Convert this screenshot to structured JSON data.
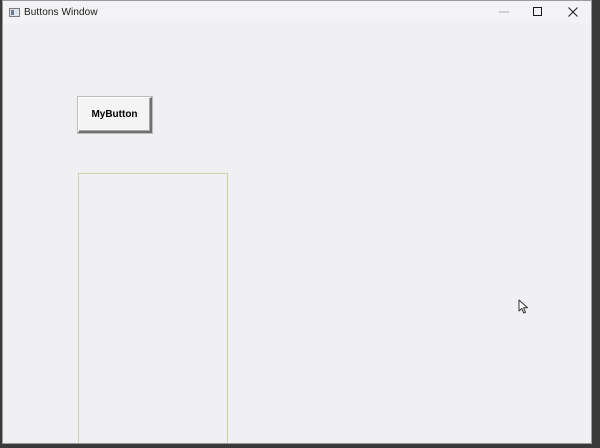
{
  "window": {
    "title": "Buttons Window",
    "icons": {
      "app": "app-icon",
      "minimize": "minimize-icon",
      "maximize": "maximize-icon",
      "close": "close-icon",
      "cursor": "mouse-pointer-icon"
    }
  },
  "content": {
    "button_label": "MyButton"
  }
}
